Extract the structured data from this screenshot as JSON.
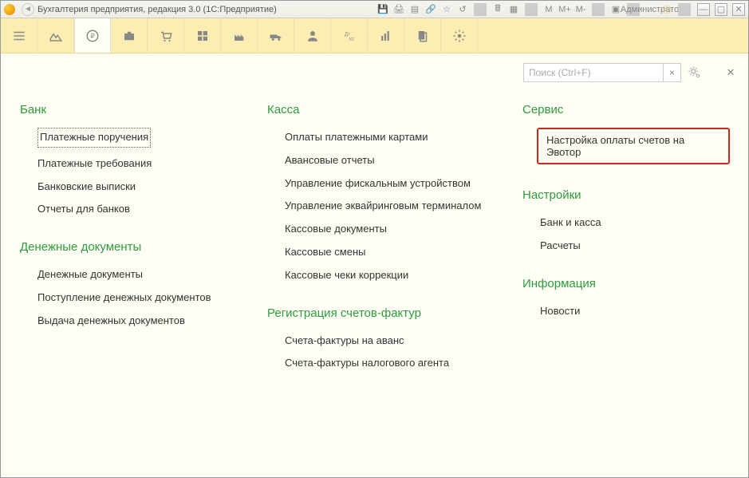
{
  "titlebar": {
    "title": "Бухгалтерия предприятия, редакция 3.0  (1С:Предприятие)",
    "memory": [
      "M",
      "M+",
      "M-"
    ],
    "user": "Администратор"
  },
  "search": {
    "placeholder": "Поиск (Ctrl+F)"
  },
  "col1": {
    "bank": {
      "heading": "Банк",
      "items": [
        "Платежные поручения",
        "Платежные требования",
        "Банковские выписки",
        "Отчеты для банков"
      ]
    },
    "money_docs": {
      "heading": "Денежные документы",
      "items": [
        "Денежные документы",
        "Поступление денежных документов",
        "Выдача денежных документов"
      ]
    }
  },
  "col2": {
    "kassa": {
      "heading": "Касса",
      "items": [
        "Оплаты платежными картами",
        "Авансовые отчеты",
        "Управление фискальным устройством",
        "Управление эквайринговым терминалом",
        "Кассовые документы",
        "Кассовые смены",
        "Кассовые чеки коррекции"
      ]
    },
    "invoices": {
      "heading": "Регистрация счетов-фактур",
      "items": [
        "Счета-фактуры на аванс",
        "Счета-фактуры налогового агента"
      ]
    }
  },
  "col3": {
    "service": {
      "heading": "Сервис",
      "highlighted": "Настройка оплаты счетов на Эвотор"
    },
    "settings": {
      "heading": "Настройки",
      "items": [
        "Банк и касса",
        "Расчеты"
      ]
    },
    "info": {
      "heading": "Информация",
      "items": [
        "Новости"
      ]
    }
  }
}
